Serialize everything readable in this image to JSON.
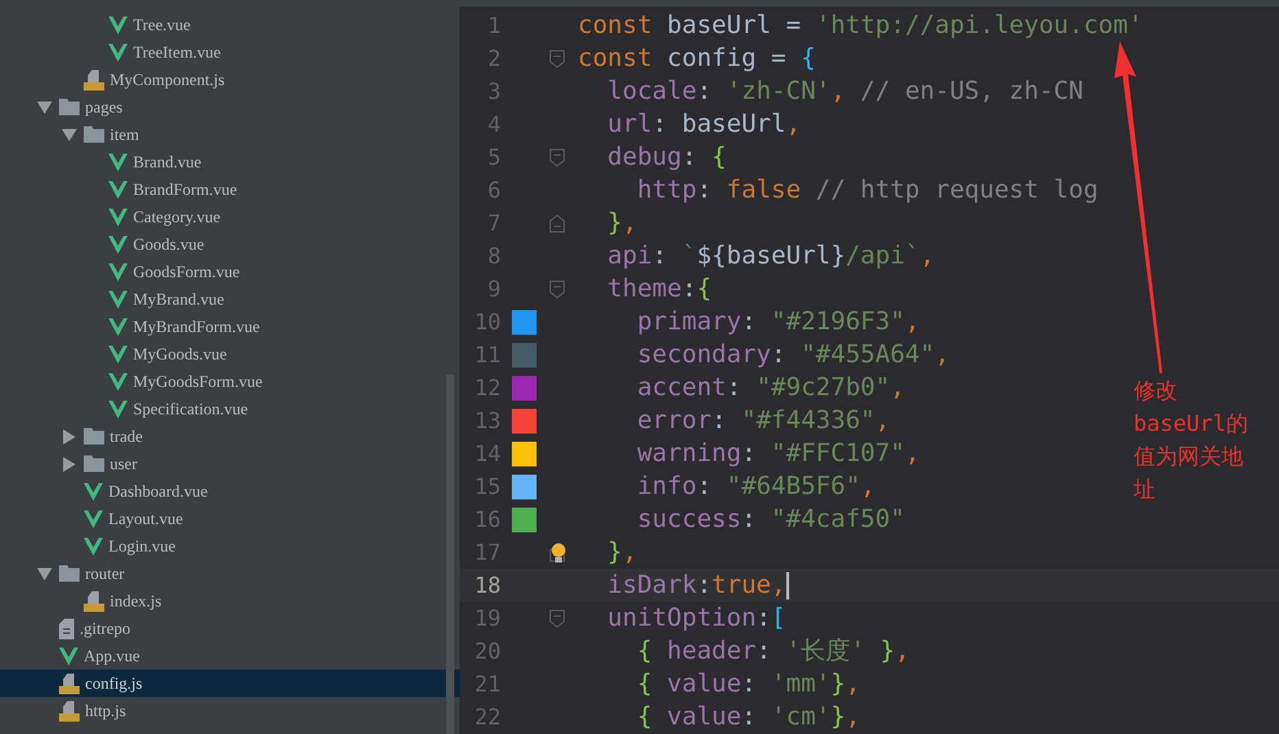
{
  "file_tree": [
    {
      "children": [
        {
          "children": [
            {
              "name": "Tree.vue",
              "kind": "vue",
              "selected": false
            },
            {
              "name": "TreeItem.vue",
              "kind": "vue",
              "selected": false
            }
          ]
        },
        {
          "name": "MyComponent.js",
          "kind": "js",
          "selected": false
        }
      ]
    },
    {
      "name": "pages",
      "kind": "folder",
      "expanded": true,
      "selected": false,
      "children": [
        {
          "name": "item",
          "kind": "folder",
          "expanded": true,
          "selected": false,
          "children": [
            {
              "name": "Brand.vue",
              "kind": "vue",
              "selected": false
            },
            {
              "name": "BrandForm.vue",
              "kind": "vue",
              "selected": false
            },
            {
              "name": "Category.vue",
              "kind": "vue",
              "selected": false
            },
            {
              "name": "Goods.vue",
              "kind": "vue",
              "selected": false
            },
            {
              "name": "GoodsForm.vue",
              "kind": "vue",
              "selected": false
            },
            {
              "name": "MyBrand.vue",
              "kind": "vue",
              "selected": false
            },
            {
              "name": "MyBrandForm.vue",
              "kind": "vue",
              "selected": false
            },
            {
              "name": "MyGoods.vue",
              "kind": "vue",
              "selected": false
            },
            {
              "name": "MyGoodsForm.vue",
              "kind": "vue",
              "selected": false
            },
            {
              "name": "Specification.vue",
              "kind": "vue",
              "selected": false
            }
          ]
        },
        {
          "name": "trade",
          "kind": "folder",
          "expanded": false,
          "selected": false
        },
        {
          "name": "user",
          "kind": "folder",
          "expanded": false,
          "selected": false
        },
        {
          "name": "Dashboard.vue",
          "kind": "vue",
          "selected": false
        },
        {
          "name": "Layout.vue",
          "kind": "vue",
          "selected": false
        },
        {
          "name": "Login.vue",
          "kind": "vue",
          "selected": false
        }
      ]
    },
    {
      "name": "router",
      "kind": "folder",
      "expanded": true,
      "selected": false,
      "children": [
        {
          "name": "index.js",
          "kind": "js",
          "selected": false
        }
      ]
    },
    {
      "name": ".gitrepo",
      "kind": "text",
      "selected": false
    },
    {
      "name": "App.vue",
      "kind": "vue",
      "selected": false
    },
    {
      "name": "config.js",
      "kind": "js",
      "selected": true
    },
    {
      "name": "http.js",
      "kind": "js",
      "selected": false
    }
  ],
  "editor": {
    "lines": [
      {
        "number": "1",
        "current": false,
        "tokens": [
          {
            "kind": "keyword",
            "text": "const "
          },
          {
            "kind": "plain",
            "text": "baseUrl = "
          },
          {
            "kind": "string",
            "text": "'http://api.leyou.com'"
          }
        ]
      },
      {
        "number": "2",
        "current": false,
        "fold_start": true,
        "tokens": [
          {
            "kind": "keyword",
            "text": "const "
          },
          {
            "kind": "plain",
            "text": "config = "
          },
          {
            "kind": "bracket",
            "text": "{"
          }
        ]
      },
      {
        "number": "3",
        "current": false,
        "tokens": [
          {
            "kind": "property",
            "text": "  locale"
          },
          {
            "kind": "plain",
            "text": ": "
          },
          {
            "kind": "string",
            "text": "'zh-CN'"
          },
          {
            "kind": "punct",
            "text": ","
          },
          {
            "kind": "comment",
            "text": " // en-US, zh-CN"
          }
        ]
      },
      {
        "number": "4",
        "current": false,
        "tokens": [
          {
            "kind": "property",
            "text": "  url"
          },
          {
            "kind": "plain",
            "text": ": baseUrl"
          },
          {
            "kind": "punct",
            "text": ","
          }
        ]
      },
      {
        "number": "5",
        "current": false,
        "fold_start": true,
        "tokens": [
          {
            "kind": "property",
            "text": "  debug"
          },
          {
            "kind": "plain",
            "text": ": "
          },
          {
            "kind": "brace",
            "text": "{"
          }
        ]
      },
      {
        "number": "6",
        "current": false,
        "tokens": [
          {
            "kind": "property",
            "text": "    http"
          },
          {
            "kind": "plain",
            "text": ": "
          },
          {
            "kind": "keyword",
            "text": "false"
          },
          {
            "kind": "comment",
            "text": " // http request log"
          }
        ]
      },
      {
        "number": "7",
        "current": false,
        "fold_end": true,
        "tokens": [
          {
            "kind": "brace",
            "text": "  }"
          },
          {
            "kind": "punct",
            "text": ","
          }
        ]
      },
      {
        "number": "8",
        "current": false,
        "tokens": [
          {
            "kind": "property",
            "text": "  api"
          },
          {
            "kind": "plain",
            "text": ": "
          },
          {
            "kind": "string",
            "text": "`"
          },
          {
            "kind": "plain",
            "text": "${baseUrl}"
          },
          {
            "kind": "string",
            "text": "/api`"
          },
          {
            "kind": "punct",
            "text": ","
          }
        ]
      },
      {
        "number": "9",
        "current": false,
        "fold_start": true,
        "tokens": [
          {
            "kind": "property",
            "text": "  theme"
          },
          {
            "kind": "plain",
            "text": ":"
          },
          {
            "kind": "brace",
            "text": "{"
          }
        ]
      },
      {
        "number": "10",
        "current": false,
        "color": "#2196f3",
        "tokens": [
          {
            "kind": "property",
            "text": "    primary"
          },
          {
            "kind": "plain",
            "text": ": "
          },
          {
            "kind": "string",
            "text": "\"#2196F3\""
          },
          {
            "kind": "punct",
            "text": ","
          }
        ]
      },
      {
        "number": "11",
        "current": false,
        "color": "#455a64",
        "tokens": [
          {
            "kind": "property",
            "text": "    secondary"
          },
          {
            "kind": "plain",
            "text": ": "
          },
          {
            "kind": "string",
            "text": "\"#455A64\""
          },
          {
            "kind": "punct",
            "text": ","
          }
        ]
      },
      {
        "number": "12",
        "current": false,
        "color": "#9c27b0",
        "tokens": [
          {
            "kind": "property",
            "text": "    accent"
          },
          {
            "kind": "plain",
            "text": ": "
          },
          {
            "kind": "string",
            "text": "\"#9c27b0\""
          },
          {
            "kind": "punct",
            "text": ","
          }
        ]
      },
      {
        "number": "13",
        "current": false,
        "color": "#f44336",
        "tokens": [
          {
            "kind": "property",
            "text": "    error"
          },
          {
            "kind": "plain",
            "text": ": "
          },
          {
            "kind": "string",
            "text": "\"#f44336\""
          },
          {
            "kind": "punct",
            "text": ","
          }
        ]
      },
      {
        "number": "14",
        "current": false,
        "color": "#ffc107",
        "tokens": [
          {
            "kind": "property",
            "text": "    warning"
          },
          {
            "kind": "plain",
            "text": ": "
          },
          {
            "kind": "string",
            "text": "\"#FFC107\""
          },
          {
            "kind": "punct",
            "text": ","
          }
        ]
      },
      {
        "number": "15",
        "current": false,
        "color": "#64b5f6",
        "tokens": [
          {
            "kind": "property",
            "text": "    info"
          },
          {
            "kind": "plain",
            "text": ": "
          },
          {
            "kind": "string",
            "text": "\"#64B5F6\""
          },
          {
            "kind": "punct",
            "text": ","
          }
        ]
      },
      {
        "number": "16",
        "current": false,
        "color": "#4caf50",
        "tokens": [
          {
            "kind": "property",
            "text": "    success"
          },
          {
            "kind": "plain",
            "text": ": "
          },
          {
            "kind": "string",
            "text": "\"#4caf50\""
          }
        ]
      },
      {
        "number": "17",
        "current": false,
        "fold_end": true,
        "bulb": true,
        "tokens": [
          {
            "kind": "brace",
            "text": "  }"
          },
          {
            "kind": "punct",
            "text": ","
          }
        ]
      },
      {
        "number": "18",
        "current": true,
        "tokens": [
          {
            "kind": "property",
            "text": "  isDark"
          },
          {
            "kind": "plain",
            "text": ":"
          },
          {
            "kind": "keyword",
            "text": "true"
          },
          {
            "kind": "punct",
            "text": ","
          }
        ]
      },
      {
        "number": "19",
        "current": false,
        "fold_start": true,
        "tokens": [
          {
            "kind": "property",
            "text": "  unitOption"
          },
          {
            "kind": "plain",
            "text": ":"
          },
          {
            "kind": "bracket",
            "text": "["
          }
        ]
      },
      {
        "number": "20",
        "current": false,
        "tokens": [
          {
            "kind": "brace",
            "text": "    { "
          },
          {
            "kind": "property",
            "text": "header"
          },
          {
            "kind": "plain",
            "text": ": "
          },
          {
            "kind": "string",
            "text": "'长度'"
          },
          {
            "kind": "brace",
            "text": " }"
          },
          {
            "kind": "punct",
            "text": ","
          }
        ]
      },
      {
        "number": "21",
        "current": false,
        "tokens": [
          {
            "kind": "brace",
            "text": "    { "
          },
          {
            "kind": "property",
            "text": "value"
          },
          {
            "kind": "plain",
            "text": ": "
          },
          {
            "kind": "string",
            "text": "'mm'"
          },
          {
            "kind": "brace",
            "text": "}"
          },
          {
            "kind": "punct",
            "text": ","
          }
        ]
      },
      {
        "number": "22",
        "current": false,
        "tokens": [
          {
            "kind": "brace",
            "text": "    { "
          },
          {
            "kind": "property",
            "text": "value"
          },
          {
            "kind": "plain",
            "text": ": "
          },
          {
            "kind": "string",
            "text": "'cm'"
          },
          {
            "kind": "brace",
            "text": "}"
          },
          {
            "kind": "punct",
            "text": ","
          }
        ]
      }
    ]
  },
  "annotation": {
    "text": "修改baseUrl的值为网关地址"
  }
}
